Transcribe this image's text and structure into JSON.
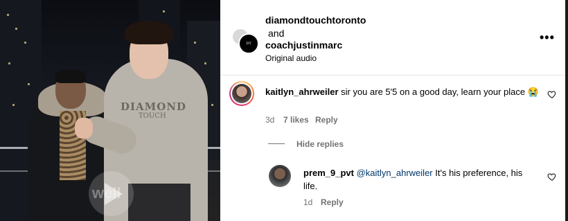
{
  "header": {
    "user1": "diamondtouchtoronto",
    "and_text": "and",
    "user2": "coachjustinmarc",
    "audio": "Original audio",
    "more_icon": "more-horizontal-icon"
  },
  "video": {
    "hoodie_text_1": "DIAMOND",
    "hoodie_text_2": "TOUCH",
    "watermark": "well",
    "play_icon": "play-icon"
  },
  "comment1": {
    "username": "kaitlyn_ahrweiler",
    "text": " sir you are 5'5 on a good day, learn your place 😭",
    "time": "3d",
    "likes": "7 likes",
    "reply": "Reply",
    "hide_replies": "Hide replies"
  },
  "comment2": {
    "username": "prem_9_pvt",
    "mention": "@kaitlyn_ahrweiler",
    "text": " It's his preference, his life.",
    "time": "1d",
    "reply": "Reply"
  }
}
